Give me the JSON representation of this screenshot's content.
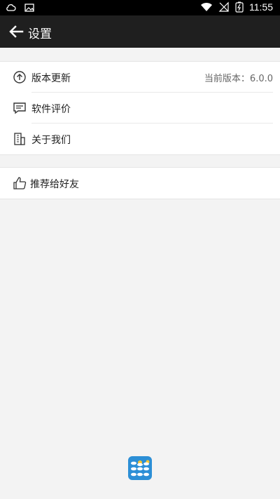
{
  "status_bar": {
    "time": "11:55",
    "left_icons": [
      "cloud-icon",
      "image-icon"
    ],
    "right_icons": [
      "wifi-icon",
      "no-signal-icon",
      "battery-charging-icon"
    ]
  },
  "toolbar": {
    "back_icon": "arrow-left-icon",
    "title": "设置"
  },
  "settings": {
    "group1": [
      {
        "label": "版本更新",
        "value": "当前版本：6.0.0",
        "icon": "upload-circle-icon"
      },
      {
        "label": "软件评价",
        "icon": "comment-icon"
      },
      {
        "label": "关于我们",
        "icon": "building-icon"
      }
    ],
    "group2": [
      {
        "label": "推荐给好友",
        "icon": "thumb-up-icon"
      }
    ]
  },
  "footer": {
    "app_icon": "weather-app-icon"
  },
  "colors": {
    "status_bar_bg": "#000000",
    "toolbar_bg": "#1f1f1f",
    "page_bg": "#f3f3f3",
    "card_bg": "#ffffff"
  }
}
